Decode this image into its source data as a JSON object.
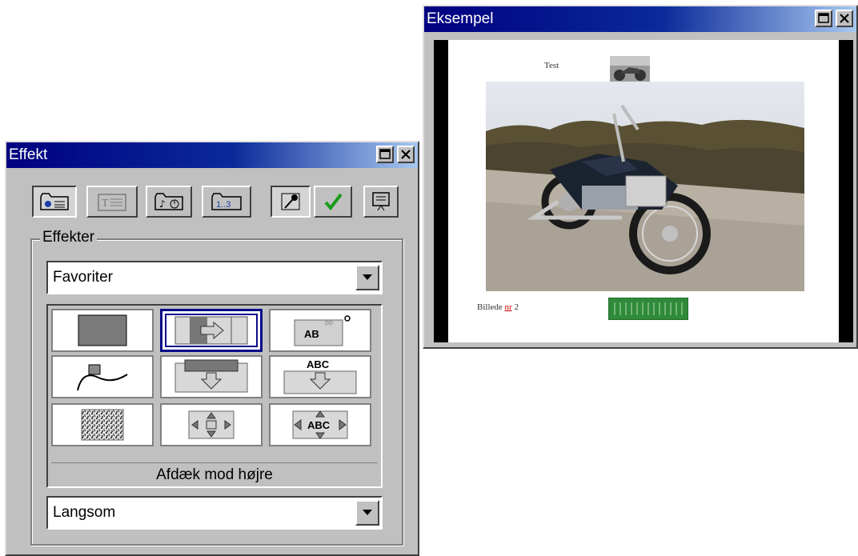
{
  "effekt_window": {
    "title": "Effekt",
    "group_label": "Effekter",
    "category": "Favoriter",
    "selected_effect_name": "Afdæk mod højre",
    "speed": "Langsom",
    "effects": [
      {
        "icon": "solid-fill-icon",
        "selected": false,
        "label": ""
      },
      {
        "icon": "cover-right-icon",
        "selected": true,
        "label": ""
      },
      {
        "icon": "text-fly-corner-icon",
        "selected": false,
        "label": "AB"
      },
      {
        "icon": "motion-path-icon",
        "selected": false,
        "label": ""
      },
      {
        "icon": "drop-down-icon",
        "selected": false,
        "label": ""
      },
      {
        "icon": "text-drop-icon",
        "selected": false,
        "label": "ABC"
      },
      {
        "icon": "dissolve-icon",
        "selected": false,
        "label": ""
      },
      {
        "icon": "expand-icon",
        "selected": false,
        "label": ""
      },
      {
        "icon": "text-expand-icon",
        "selected": false,
        "label": "ABC"
      }
    ]
  },
  "eksempel_window": {
    "title": "Eksempel",
    "slide_title": "Test",
    "caption": "Billede",
    "caption_link": "nr",
    "caption_number": "2"
  },
  "colors": {
    "titlebar_start": "#000080",
    "titlebar_end": "#a8c8f0",
    "window_face": "#c0c0c0",
    "progress_green": "#2f8a3a"
  }
}
